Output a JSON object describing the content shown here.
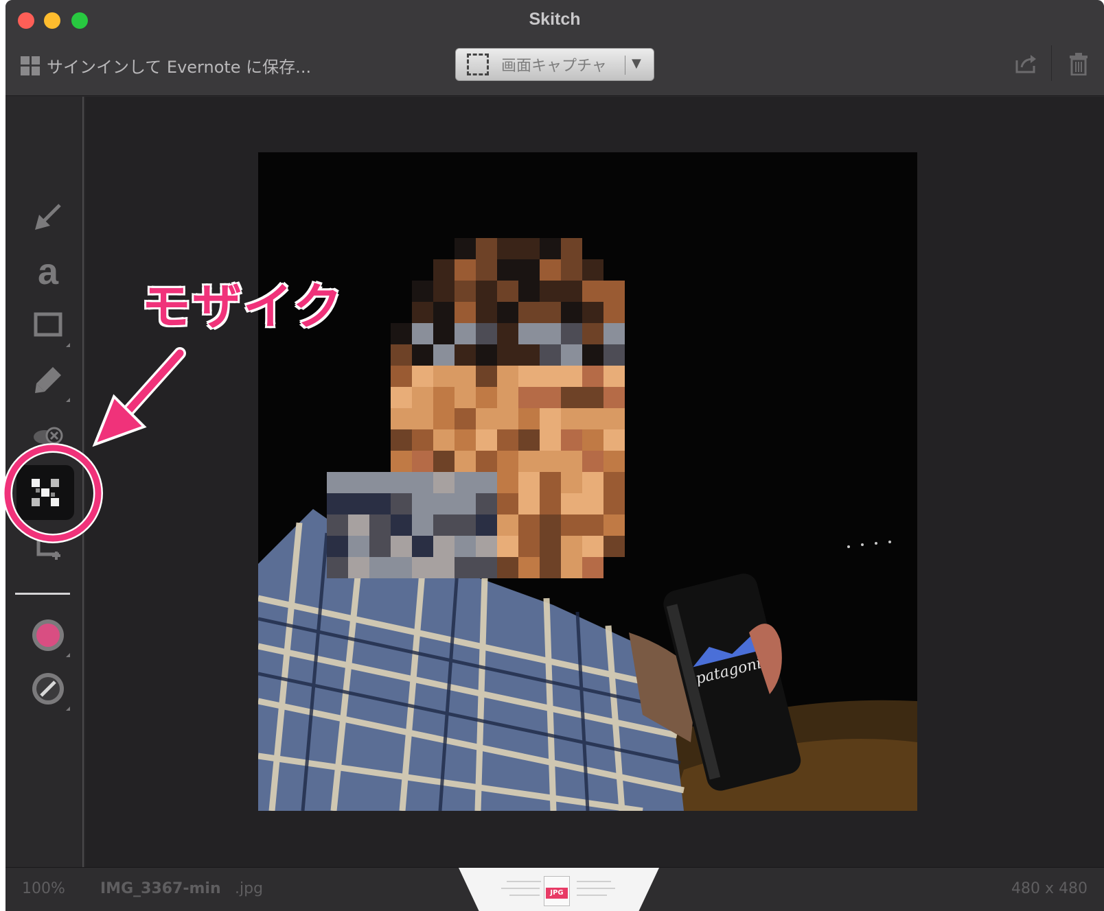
{
  "window": {
    "title": "Skitch",
    "signin_label": "サインインして Evernote に保存...",
    "capture_label": "画面キャプチャ"
  },
  "toolbar": {
    "tools": [
      {
        "name": "arrow",
        "icon": "arrow-icon"
      },
      {
        "name": "text",
        "icon": "text-icon",
        "glyph": "a"
      },
      {
        "name": "rectangle",
        "icon": "rectangle-icon"
      },
      {
        "name": "marker",
        "icon": "marker-icon"
      },
      {
        "name": "stamp",
        "icon": "stamp-icon"
      },
      {
        "name": "pixelate",
        "icon": "pixelate-icon",
        "active": true
      },
      {
        "name": "crop",
        "icon": "crop-icon"
      }
    ],
    "color_swatch": "#d94e82",
    "accent": "#f0327a"
  },
  "annotation": {
    "label": "モザイク"
  },
  "status": {
    "zoom": "100%",
    "filename": "IMG_3367-min",
    "extension": ".jpg",
    "dimensions": "480 x 480",
    "format_badge": "JPG"
  }
}
